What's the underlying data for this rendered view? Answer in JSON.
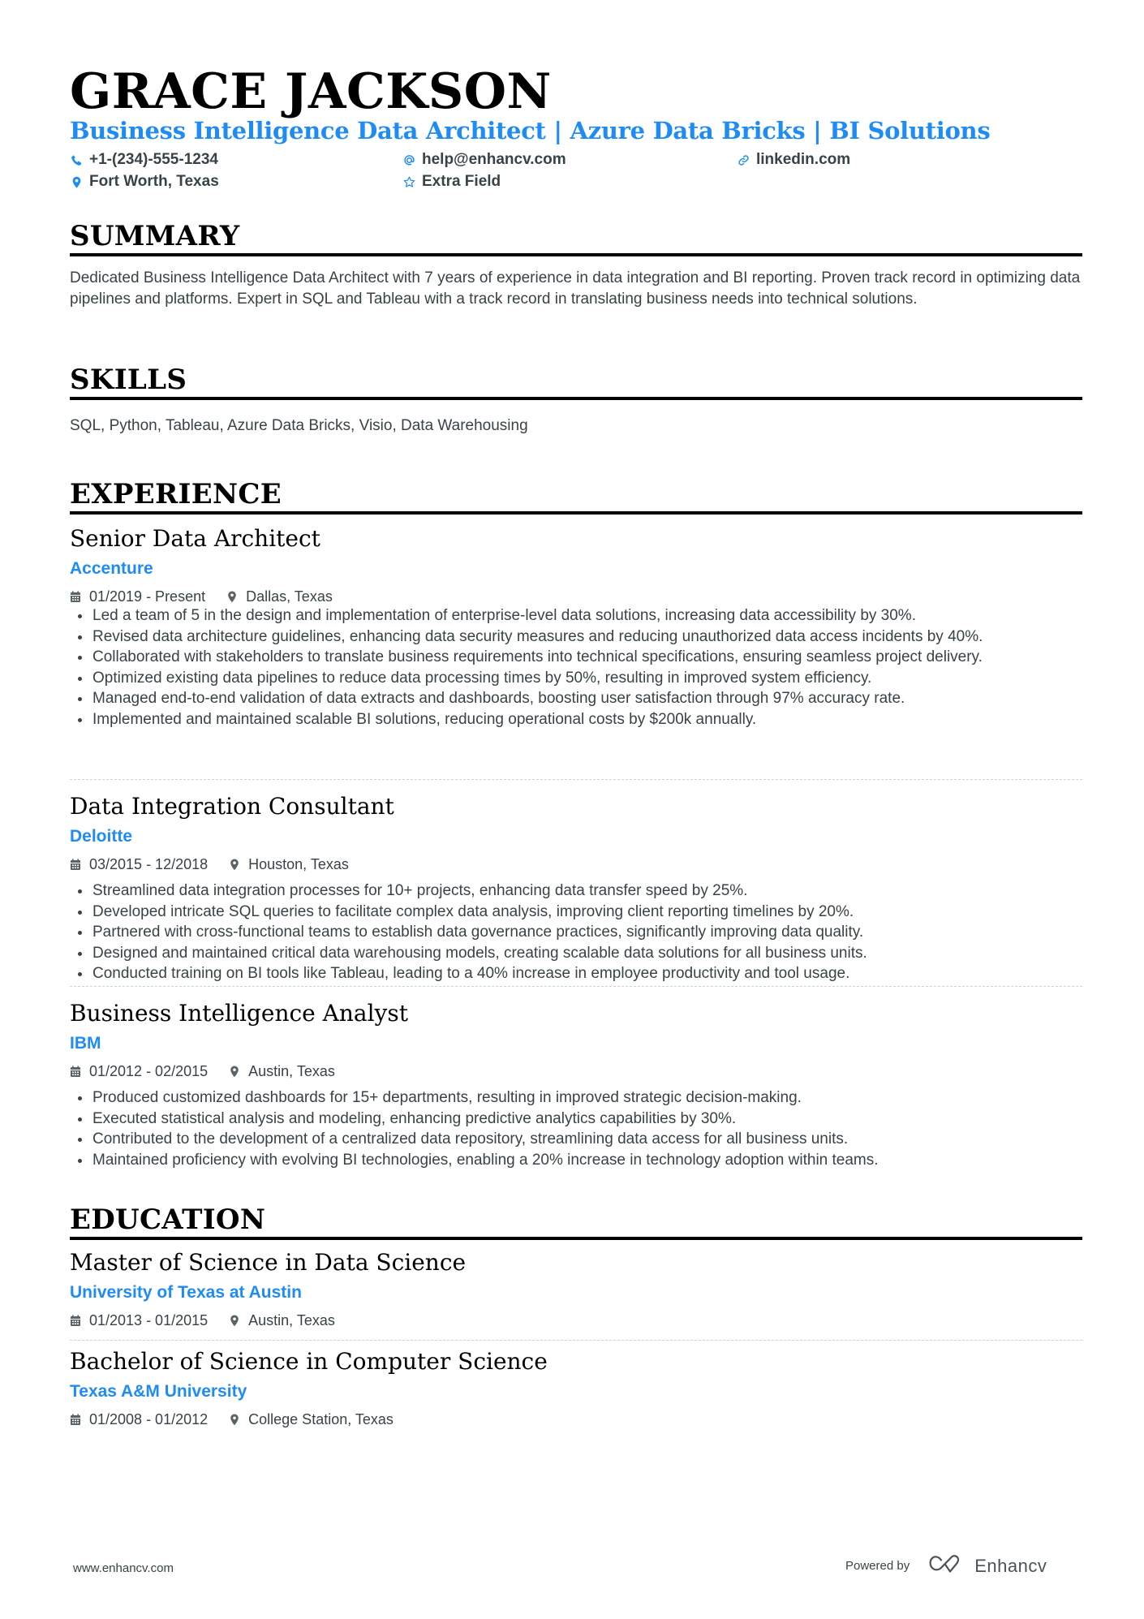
{
  "header": {
    "name": "GRACE JACKSON",
    "headline": "Business Intelligence Data Architect | Azure Data Bricks | BI Solutions",
    "contacts": [
      {
        "icon": "phone-icon",
        "text": "+1-(234)-555-1234"
      },
      {
        "icon": "at-sign-icon",
        "text": "help@enhancv.com"
      },
      {
        "icon": "link-icon",
        "text": "linkedin.com"
      },
      {
        "icon": "location-pin-icon",
        "text": "Fort Worth, Texas"
      },
      {
        "icon": "star-icon",
        "text": "Extra Field"
      }
    ]
  },
  "colors": {
    "accent": "#1f8cf4",
    "text": "#384347",
    "heading": "#000000"
  },
  "summary": {
    "title": "SUMMARY",
    "text": "Dedicated Business Intelligence Data Architect with 7 years of experience in data integration and BI reporting. Proven track record in optimizing data pipelines and platforms. Expert in SQL and Tableau with a track record in translating business needs into technical solutions."
  },
  "skills": {
    "title": "SKILLS",
    "text": "SQL, Python, Tableau, Azure Data Bricks, Visio, Data Warehousing"
  },
  "experience": {
    "title": "EXPERIENCE",
    "jobs": [
      {
        "title": "Senior Data Architect",
        "company": "Accenture",
        "dates": "01/2019 - Present",
        "location": "Dallas, Texas",
        "bullets": [
          "Led a team of 5 in the design and implementation of enterprise-level data solutions, increasing data accessibility by 30%.",
          "Revised data architecture guidelines, enhancing data security measures and reducing unauthorized data access incidents by 40%.",
          "Collaborated with stakeholders to translate business requirements into technical specifications, ensuring seamless project delivery.",
          "Optimized existing data pipelines to reduce data processing times by 50%, resulting in improved system efficiency.",
          "Managed end-to-end validation of data extracts and dashboards, boosting user satisfaction through 97% accuracy rate.",
          "Implemented and maintained scalable BI solutions, reducing operational costs by $200k annually."
        ]
      },
      {
        "title": "Data Integration Consultant",
        "company": "Deloitte",
        "dates": "03/2015 - 12/2018",
        "location": "Houston, Texas",
        "bullets": [
          "Streamlined data integration processes for 10+ projects, enhancing data transfer speed by 25%.",
          "Developed intricate SQL queries to facilitate complex data analysis, improving client reporting timelines by 20%.",
          "Partnered with cross-functional teams to establish data governance practices, significantly improving data quality.",
          "Designed and maintained critical data warehousing models, creating scalable data solutions for all business units.",
          "Conducted training on BI tools like Tableau, leading to a 40% increase in employee productivity and tool usage."
        ]
      },
      {
        "title": "Business Intelligence Analyst",
        "company": "IBM",
        "dates": "01/2012 - 02/2015",
        "location": "Austin, Texas",
        "bullets": [
          "Produced customized dashboards for 15+ departments, resulting in improved strategic decision-making.",
          "Executed statistical analysis and modeling, enhancing predictive analytics capabilities by 30%.",
          "Contributed to the development of a centralized data repository, streamlining data access for all business units.",
          "Maintained proficiency with evolving BI technologies, enabling a 20% increase in technology adoption within teams."
        ]
      }
    ]
  },
  "education": {
    "title": "EDUCATION",
    "items": [
      {
        "degree": "Master of Science in Data Science",
        "school": "University of Texas at Austin",
        "dates": "01/2013 - 01/2015",
        "location": "Austin, Texas"
      },
      {
        "degree": "Bachelor of Science in Computer Science",
        "school": "Texas A&M University",
        "dates": "01/2008 - 01/2012",
        "location": "College Station, Texas"
      }
    ]
  },
  "footer": {
    "website": "www.enhancv.com",
    "powered_by": "Powered by",
    "brand": "Enhancv"
  }
}
